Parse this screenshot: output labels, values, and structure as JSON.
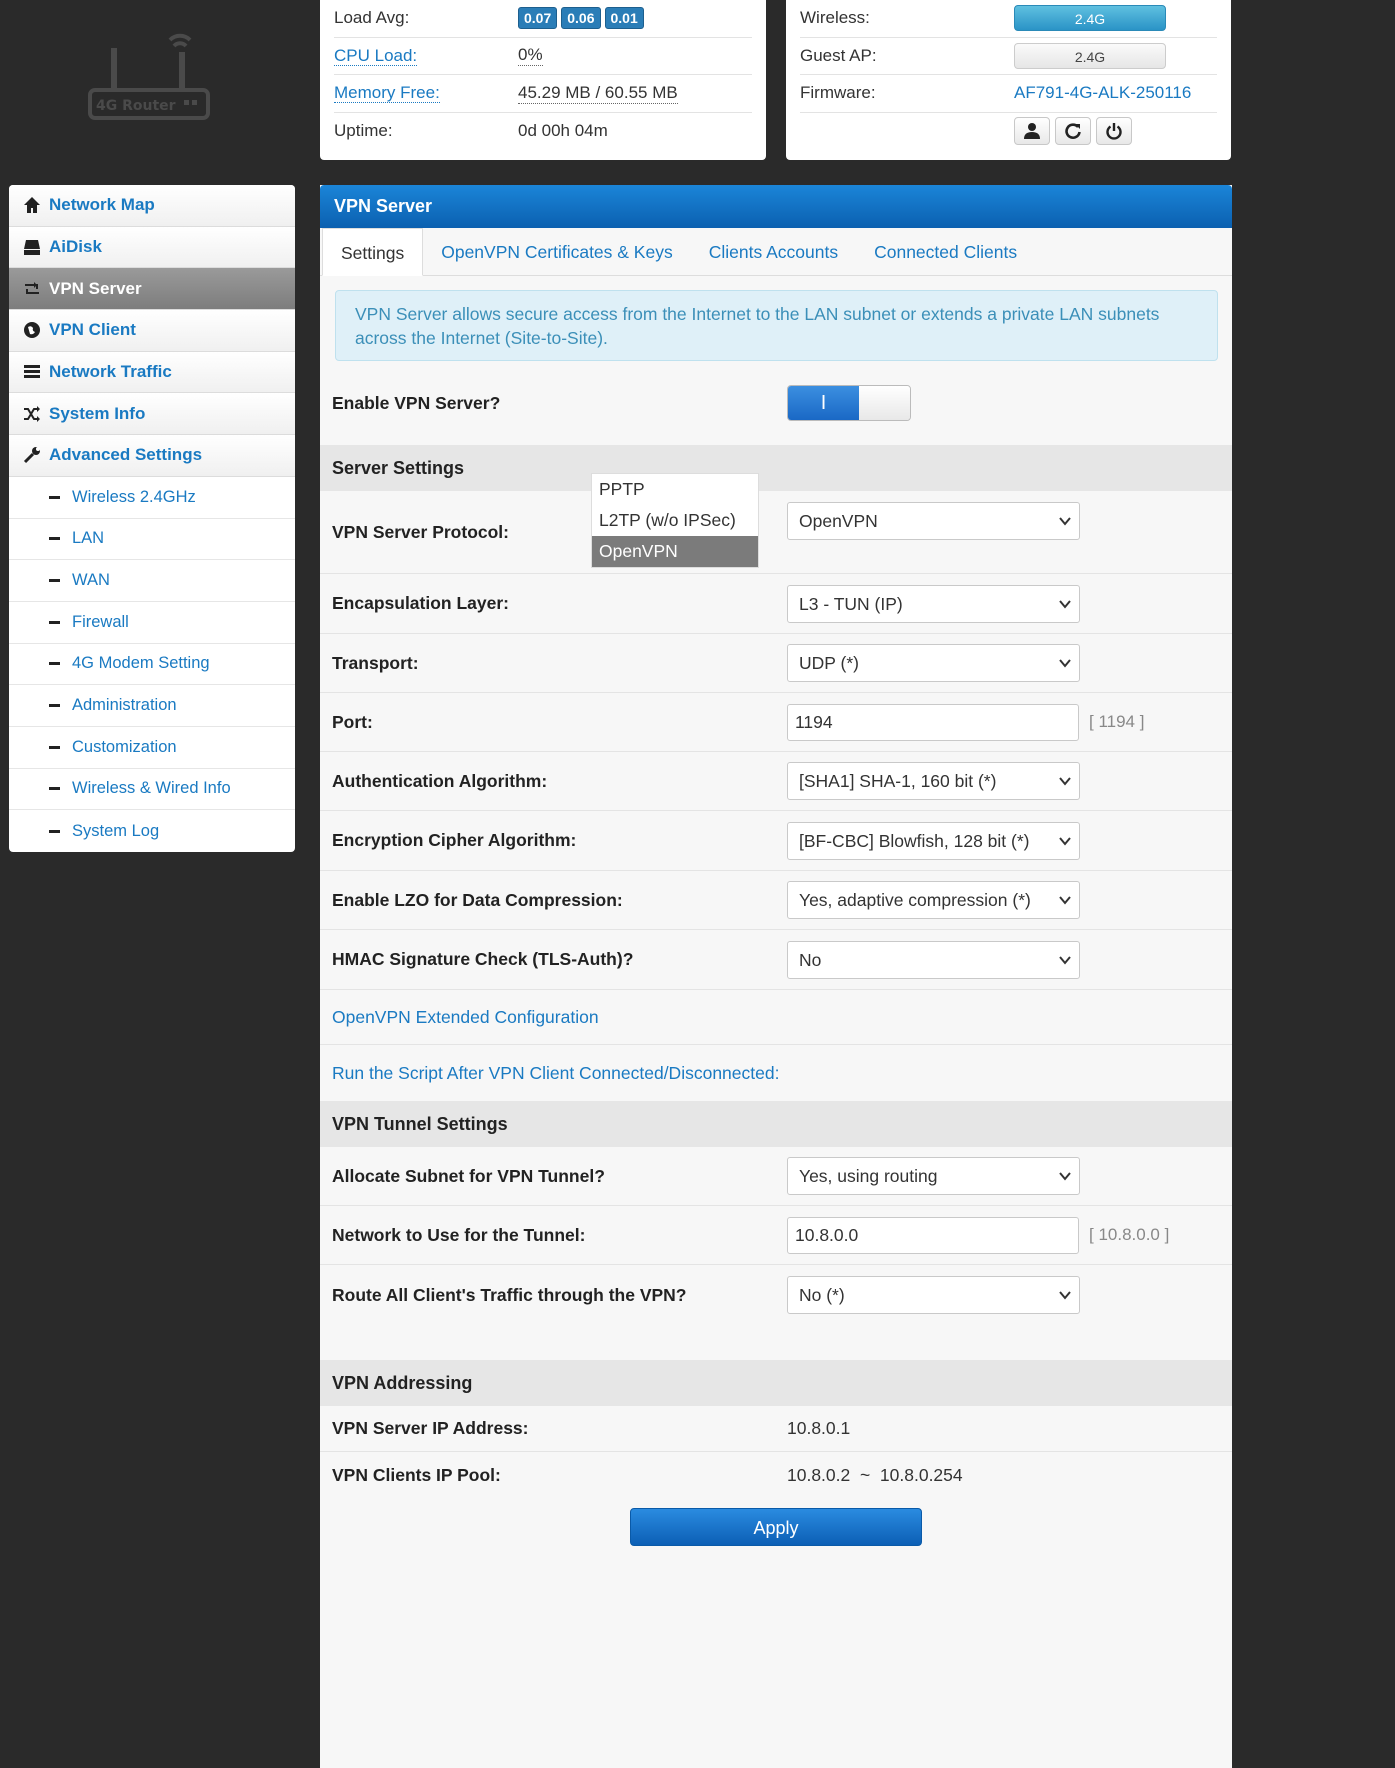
{
  "logo": {
    "text": "4G Router"
  },
  "status_left": [
    {
      "key": "Load Avg:",
      "link": false,
      "badges": [
        "0.07",
        "0.06",
        "0.01"
      ]
    },
    {
      "key": "CPU Load:",
      "link": true,
      "value": "0%"
    },
    {
      "key": "Memory Free:",
      "link": true,
      "value": "45.29 MB / 60.55 MB"
    },
    {
      "key": "Uptime:",
      "link": false,
      "value": "0d 00h 04m"
    }
  ],
  "status_right": {
    "wireless_label": "Wireless:",
    "wireless_value": "2.4G",
    "guest_label": "Guest AP:",
    "guest_value": "2.4G",
    "firmware_label": "Firmware:",
    "firmware_value": "AF791-4G-ALK-250116",
    "buttons": [
      "user-icon",
      "refresh-icon",
      "power-icon"
    ]
  },
  "sidebar": {
    "items": [
      {
        "label": "Network Map",
        "icon": "home-icon"
      },
      {
        "label": "AiDisk",
        "icon": "disk-icon"
      },
      {
        "label": "VPN Server",
        "icon": "vpn-server-icon",
        "active": true
      },
      {
        "label": "VPN Client",
        "icon": "globe-icon"
      },
      {
        "label": "Network Traffic",
        "icon": "list-icon"
      },
      {
        "label": "System Info",
        "icon": "shuffle-icon"
      },
      {
        "label": "Advanced Settings",
        "icon": "wrench-icon"
      }
    ],
    "subitems": [
      "Wireless 2.4GHz",
      "LAN",
      "WAN",
      "Firewall",
      "4G Modem Setting",
      "Administration",
      "Customization",
      "Wireless & Wired Info",
      "System Log"
    ]
  },
  "main": {
    "title": "VPN Server",
    "tabs": [
      "Settings",
      "OpenVPN Certificates & Keys",
      "Clients Accounts",
      "Connected Clients"
    ],
    "info": "VPN Server allows secure access from the Internet to the LAN subnet or extends a private LAN subnets across the Internet (Site-to-Site).",
    "enable_label": "Enable VPN Server?",
    "enable_on_text": "I",
    "server_settings_title": "Server Settings",
    "protocol_label": "VPN Server Protocol:",
    "protocol_value": "OpenVPN",
    "protocol_options": [
      "PPTP",
      "L2TP (w/o IPSec)",
      "OpenVPN"
    ],
    "encapsulation_label": "Encapsulation Layer:",
    "encapsulation_value": "L3 - TUN (IP)",
    "transport_label": "Transport:",
    "transport_value": "UDP (*)",
    "port_label": "Port:",
    "port_value": "1194",
    "port_hint": "[ 1194 ]",
    "auth_label": "Authentication Algorithm:",
    "auth_value": "[SHA1] SHA-1, 160 bit (*)",
    "cipher_label": "Encryption Cipher Algorithm:",
    "cipher_value": "[BF-CBC] Blowfish, 128 bit (*)",
    "lzo_label": "Enable LZO for Data Compression:",
    "lzo_value": "Yes, adaptive compression (*)",
    "hmac_label": "HMAC Signature Check (TLS-Auth)?",
    "hmac_value": "No",
    "extended_link": "OpenVPN Extended Configuration",
    "script_link": "Run the Script After VPN Client Connected/Disconnected:",
    "tunnel_title": "VPN Tunnel Settings",
    "allocate_label": "Allocate Subnet for VPN Tunnel?",
    "allocate_value": "Yes, using routing",
    "network_label": "Network to Use for the Tunnel:",
    "network_value": "10.8.0.0",
    "network_hint": "[ 10.8.0.0 ]",
    "route_label": "Route All Client's Traffic through the VPN?",
    "route_value": "No (*)",
    "addressing_title": "VPN Addressing",
    "server_ip_label": "VPN Server IP Address:",
    "server_ip_value": "10.8.0.1",
    "pool_label": "VPN Clients IP Pool:",
    "pool_value": "10.8.0.2  ~  10.8.0.254",
    "apply_label": "Apply"
  }
}
